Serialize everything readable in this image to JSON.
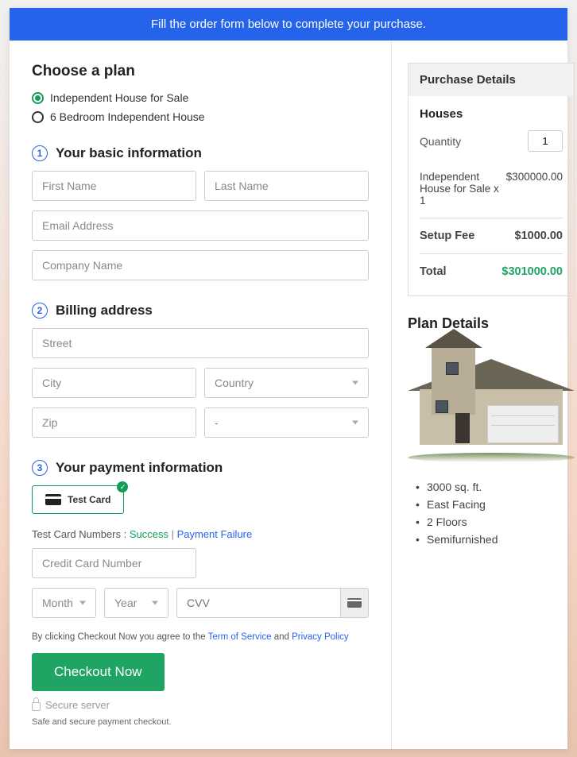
{
  "banner": "Fill the order form below to complete your purchase.",
  "plan": {
    "heading": "Choose a plan",
    "options": [
      "Independent House for Sale",
      "6 Bedroom Independent House"
    ]
  },
  "steps": {
    "s1": {
      "title": "Your basic information",
      "first": "First Name",
      "last": "Last Name",
      "email": "Email Address",
      "company": "Company Name"
    },
    "s2": {
      "title": "Billing address",
      "street": "Street",
      "city": "City",
      "country": "Country",
      "zip": "Zip",
      "state": "-"
    },
    "s3": {
      "title": "Your payment information",
      "chip": "Test  Card",
      "tlabel": "Test Card Numbers : ",
      "success": "Success",
      "sep": " | ",
      "failure": "Payment Failure",
      "cc": "Credit Card Number",
      "month": "Month",
      "year": "Year",
      "cvv": "CVV"
    }
  },
  "agree": {
    "pre": "By clicking Checkout Now you agree to the ",
    "tos": "Term of Service",
    "and": " and ",
    "pp": "Privacy Policy"
  },
  "checkout": "Checkout Now",
  "secure": "Secure server",
  "safe": "Safe and secure payment checkout.",
  "purchase": {
    "title": "Purchase Details",
    "sub": "Houses",
    "qty_label": "Quantity",
    "qty": "1",
    "item": "Independent House for Sale x 1",
    "item_price": "$300000.00",
    "setup_label": "Setup Fee",
    "setup": "$1000.00",
    "total_label": "Total",
    "total": "$301000.00"
  },
  "plan_details": {
    "title": "Plan Details",
    "features": [
      "3000 sq. ft.",
      "East Facing",
      "2 Floors",
      "Semifurnished"
    ]
  }
}
